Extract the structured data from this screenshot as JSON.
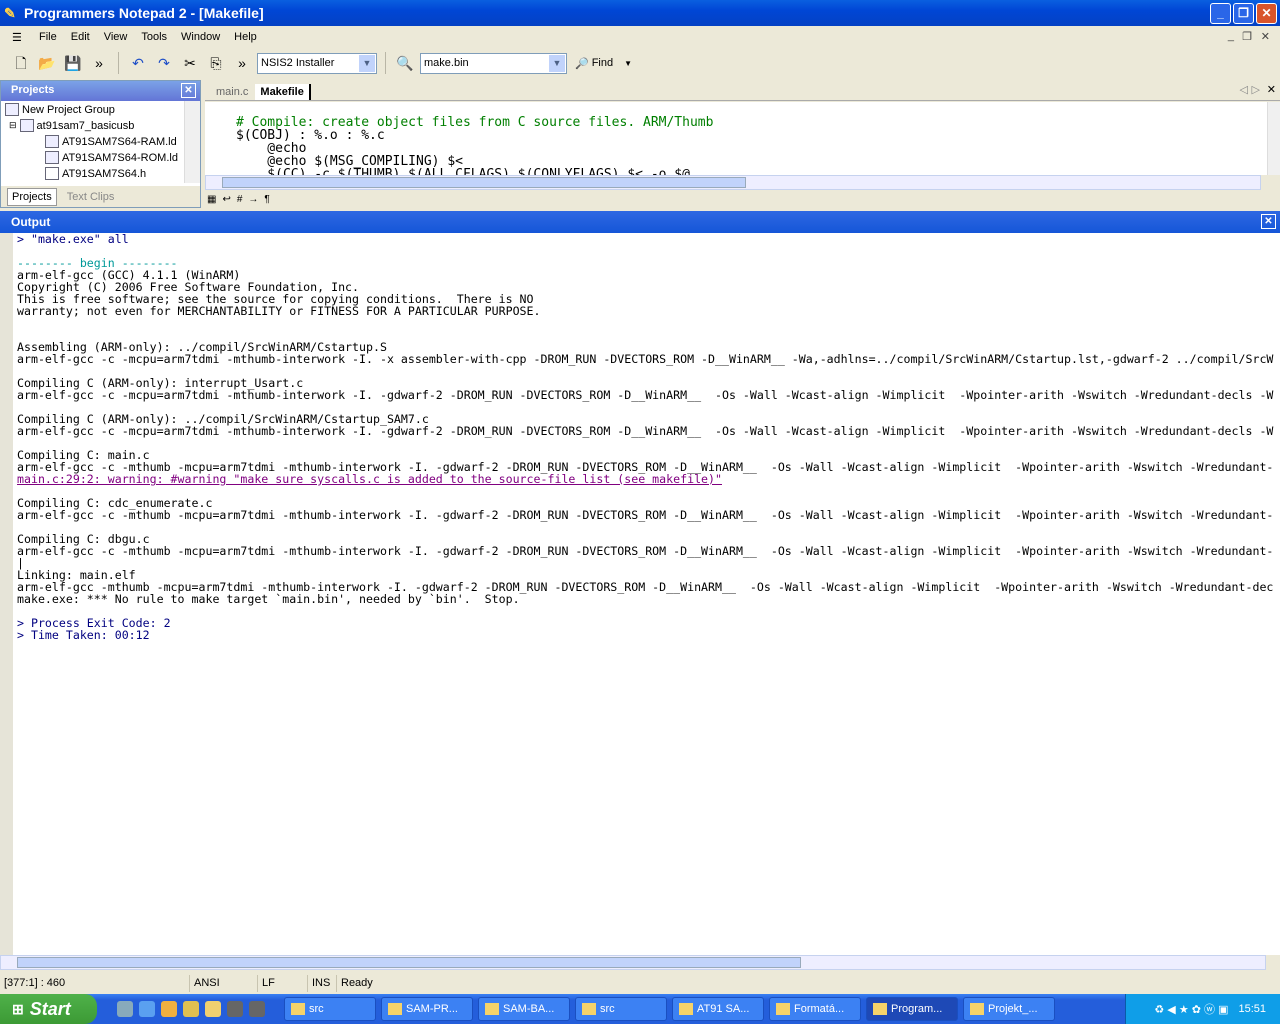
{
  "window": {
    "title": "Programmers Notepad 2 - [Makefile]"
  },
  "menu": [
    "File",
    "Edit",
    "View",
    "Tools",
    "Window",
    "Help"
  ],
  "toolbar": {
    "scheme": "NSIS2 Installer",
    "find_input": "make.bin",
    "find_label": "Find"
  },
  "projects": {
    "title": "Projects",
    "items": [
      "New Project Group",
      "at91sam7_basicusb",
      "AT91SAM7S64-RAM.ld",
      "AT91SAM7S64-ROM.ld",
      "AT91SAM7S64.h"
    ],
    "tabs": [
      "Projects",
      "Text Clips"
    ]
  },
  "editor": {
    "tabs": [
      "main.c",
      "Makefile"
    ],
    "lines": [
      {
        "t": "# Compile: create object files from C source files. ARM/Thumb",
        "c": "cm"
      },
      {
        "t": "$(COBJ) : %.o : %.c",
        "c": ""
      },
      {
        "t": "    @echo",
        "c": ""
      },
      {
        "t": "    @echo $(MSG_COMPILING) $<",
        "c": ""
      },
      {
        "t": "    $(CC) -c $(THUMB) $(ALL_CFLAGS) $(CONLYFLAGS) $< -o $@",
        "c": ""
      }
    ]
  },
  "output": {
    "title": "Output",
    "lines": [
      {
        "t": "> \"make.exe\" all",
        "c": "cmd"
      },
      {
        "t": "",
        "c": ""
      },
      {
        "t": "-------- begin --------",
        "c": "sep2"
      },
      {
        "t": "arm-elf-gcc (GCC) 4.1.1 (WinARM)",
        "c": ""
      },
      {
        "t": "Copyright (C) 2006 Free Software Foundation, Inc.",
        "c": ""
      },
      {
        "t": "This is free software; see the source for copying conditions.  There is NO",
        "c": ""
      },
      {
        "t": "warranty; not even for MERCHANTABILITY or FITNESS FOR A PARTICULAR PURPOSE.",
        "c": ""
      },
      {
        "t": "",
        "c": ""
      },
      {
        "t": "",
        "c": ""
      },
      {
        "t": "Assembling (ARM-only): ../compil/SrcWinARM/Cstartup.S",
        "c": ""
      },
      {
        "t": "arm-elf-gcc -c -mcpu=arm7tdmi -mthumb-interwork -I. -x assembler-with-cpp -DROM_RUN -DVECTORS_ROM -D__WinARM__ -Wa,-adhlns=../compil/SrcWinARM/Cstartup.lst,-gdwarf-2 ../compil/SrcW",
        "c": ""
      },
      {
        "t": "",
        "c": ""
      },
      {
        "t": "Compiling C (ARM-only): interrupt_Usart.c",
        "c": ""
      },
      {
        "t": "arm-elf-gcc -c -mcpu=arm7tdmi -mthumb-interwork -I. -gdwarf-2 -DROM_RUN -DVECTORS_ROM -D__WinARM__  -Os -Wall -Wcast-align -Wimplicit  -Wpointer-arith -Wswitch -Wredundant-decls -W",
        "c": ""
      },
      {
        "t": "",
        "c": ""
      },
      {
        "t": "Compiling C (ARM-only): ../compil/SrcWinARM/Cstartup_SAM7.c",
        "c": ""
      },
      {
        "t": "arm-elf-gcc -c -mcpu=arm7tdmi -mthumb-interwork -I. -gdwarf-2 -DROM_RUN -DVECTORS_ROM -D__WinARM__  -Os -Wall -Wcast-align -Wimplicit  -Wpointer-arith -Wswitch -Wredundant-decls -W",
        "c": ""
      },
      {
        "t": "",
        "c": ""
      },
      {
        "t": "Compiling C: main.c",
        "c": ""
      },
      {
        "t": "arm-elf-gcc -c -mthumb -mcpu=arm7tdmi -mthumb-interwork -I. -gdwarf-2 -DROM_RUN -DVECTORS_ROM -D__WinARM__  -Os -Wall -Wcast-align -Wimplicit  -Wpointer-arith -Wswitch -Wredundant-",
        "c": ""
      },
      {
        "t": "main.c:29:2: warning: #warning \"make sure syscalls.c is added to the source-file list (see makefile)\"",
        "c": "warn"
      },
      {
        "t": "",
        "c": ""
      },
      {
        "t": "Compiling C: cdc_enumerate.c",
        "c": ""
      },
      {
        "t": "arm-elf-gcc -c -mthumb -mcpu=arm7tdmi -mthumb-interwork -I. -gdwarf-2 -DROM_RUN -DVECTORS_ROM -D__WinARM__  -Os -Wall -Wcast-align -Wimplicit  -Wpointer-arith -Wswitch -Wredundant-",
        "c": ""
      },
      {
        "t": "",
        "c": ""
      },
      {
        "t": "Compiling C: dbgu.c",
        "c": ""
      },
      {
        "t": "arm-elf-gcc -c -mthumb -mcpu=arm7tdmi -mthumb-interwork -I. -gdwarf-2 -DROM_RUN -DVECTORS_ROM -D__WinARM__  -Os -Wall -Wcast-align -Wimplicit  -Wpointer-arith -Wswitch -Wredundant-",
        "c": ""
      },
      {
        "t": "|",
        "c": ""
      },
      {
        "t": "Linking: main.elf",
        "c": ""
      },
      {
        "t": "arm-elf-gcc -mthumb -mcpu=arm7tdmi -mthumb-interwork -I. -gdwarf-2 -DROM_RUN -DVECTORS_ROM -D__WinARM__  -Os -Wall -Wcast-align -Wimplicit  -Wpointer-arith -Wswitch -Wredundant-dec",
        "c": ""
      },
      {
        "t": "make.exe: *** No rule to make target `main.bin', needed by `bin'.  Stop.",
        "c": ""
      },
      {
        "t": "",
        "c": ""
      },
      {
        "t": "> Process Exit Code: 2",
        "c": "cmd"
      },
      {
        "t": "> Time Taken: 00:12",
        "c": "cmd"
      }
    ]
  },
  "status": {
    "position": "[377:1] : 460",
    "encoding": "ANSI",
    "line_ending": "LF",
    "mode": "INS",
    "state": "Ready"
  },
  "taskbar": {
    "start": "Start",
    "tasks": [
      "src",
      "SAM-PR...",
      "SAM-BA...",
      "src",
      "AT91 SA...",
      "Formatá...",
      "Program...",
      "Projekt_..."
    ],
    "active_task": 6,
    "clock": "15:51"
  }
}
